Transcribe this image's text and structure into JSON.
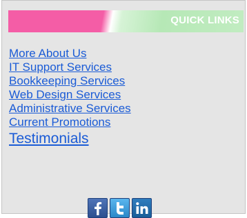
{
  "header": {
    "title": "QUICK LINKS"
  },
  "links": [
    {
      "label": "More About Us"
    },
    {
      "label": "IT Support Services"
    },
    {
      "label": "Bookkeeping Services"
    },
    {
      "label": "Web Design Services"
    },
    {
      "label": "Administrative Services"
    },
    {
      "label": "Current Promotions"
    },
    {
      "label": "Testimonials"
    }
  ],
  "social": [
    {
      "icon": "facebook-icon"
    },
    {
      "icon": "twitter-icon"
    },
    {
      "icon": "linkedin-icon"
    }
  ],
  "colors": {
    "panel_bg": "#e5e5e5",
    "link": "#1a5bd6",
    "header_pink": "#f45da6",
    "header_green": "#b6e8b6"
  }
}
